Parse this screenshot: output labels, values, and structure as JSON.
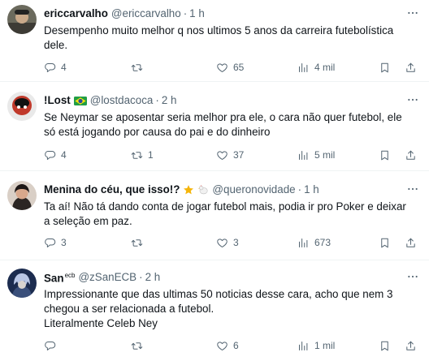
{
  "tweets": [
    {
      "name": "ericcarvalho",
      "handle": "@ericcarvalho",
      "time": "1 h",
      "lines": [
        "Desempenho muito melhor q nos ultimos 5 anos da carreira futebolística",
        "dele."
      ],
      "replies": "4",
      "retweets": "",
      "likes": "65",
      "views": "4 mil"
    },
    {
      "name": "!Lost",
      "handle": "@lostdacoca",
      "time": "2 h",
      "lines": [
        "Se Neymar se aposentar seria melhor pra ele, o cara não quer futebol, ele",
        "só está jogando por causa do pai e do dinheiro"
      ],
      "replies": "4",
      "retweets": "1",
      "likes": "37",
      "views": "5 mil"
    },
    {
      "name": "Menina do céu, que isso!?",
      "handle": "@queronovidade",
      "time": "1 h",
      "lines": [
        "Ta aí! Não tá dando conta de jogar futebol mais, podia ir pro Poker e deixar",
        "a seleção em paz."
      ],
      "replies": "3",
      "retweets": "",
      "likes": "3",
      "views": "673"
    },
    {
      "name": "San",
      "name_sup": "ecb",
      "handle": "@zSanECB",
      "time": "2 h",
      "lines": [
        "Impressionante que das ultimas 50 noticias desse cara, acho que nem 3",
        "chegou a ser relacionada a futebol.",
        "Literalmente Celeb Ney"
      ],
      "replies": "",
      "retweets": "",
      "likes": "6",
      "views": "1 mil"
    }
  ],
  "separator": "·",
  "icons": {
    "reply": "reply-icon",
    "retweet": "retweet-icon",
    "like": "heart-icon",
    "views": "views-icon",
    "bookmark": "bookmark-icon",
    "share": "share-icon",
    "more": "more-icon"
  },
  "colors": {
    "text": "#0f1419",
    "secondary": "#536471",
    "divider": "#eff3f4"
  }
}
